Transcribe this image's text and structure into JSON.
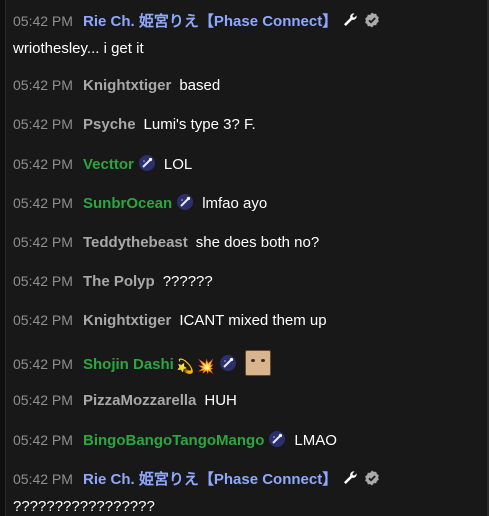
{
  "chat": {
    "messages": [
      {
        "time": "05:42 PM",
        "author": "Rie Ch. 姫宮りえ【Phase Connect】",
        "author_class": "blue",
        "badges": [
          "wrench-icon",
          "verified-icon"
        ],
        "text": "wriothesley... i get it",
        "multiline": true
      },
      {
        "time": "05:42 PM",
        "author": "Knightxtiger",
        "author_class": "gray",
        "badges": [],
        "text": "based"
      },
      {
        "time": "05:42 PM",
        "author": "Psyche",
        "author_class": "gray",
        "badges": [],
        "text": "Lumi's type 3? F."
      },
      {
        "time": "05:42 PM",
        "author": "Vecttor",
        "author_class": "green",
        "badges": [
          "member-icon"
        ],
        "text": "LOL"
      },
      {
        "time": "05:42 PM",
        "author": "SunbrOcean",
        "author_class": "green",
        "badges": [
          "member-icon"
        ],
        "text": "lmfao ayo"
      },
      {
        "time": "05:42 PM",
        "author": "Teddythebeast",
        "author_class": "gray",
        "badges": [],
        "text": "she does both no?"
      },
      {
        "time": "05:42 PM",
        "author": "The Polyp",
        "author_class": "gray",
        "badges": [],
        "text": "??????"
      },
      {
        "time": "05:42 PM",
        "author": "Knightxtiger",
        "author_class": "gray",
        "badges": [],
        "text": "ICANT mixed them up"
      },
      {
        "time": "05:42 PM",
        "author": "Shojin Dashi",
        "author_class": "green",
        "badges": [
          "dizzy-emoji",
          "collision-emoji",
          "member-icon"
        ],
        "text": "",
        "sticker": "face-sticker"
      },
      {
        "time": "05:42 PM",
        "author": "PizzaMozzarella",
        "author_class": "gray",
        "badges": [],
        "text": "HUH"
      },
      {
        "time": "05:42 PM",
        "author": "BingoBangoTangoMango",
        "author_class": "green",
        "badges": [
          "member-icon"
        ],
        "text": "LMAO"
      },
      {
        "time": "05:42 PM",
        "author": "Rie Ch. 姫宮りえ【Phase Connect】",
        "author_class": "blue",
        "badges": [
          "wrench-icon",
          "verified-icon"
        ],
        "text": "?????????????????",
        "multiline": true
      }
    ]
  },
  "colors": {
    "background": "#181818",
    "timestamp": "#8f8f8f",
    "member_name": "#2ba640",
    "owner_name": "#8fa8ff",
    "viewer_name": "#a8a8a8"
  }
}
